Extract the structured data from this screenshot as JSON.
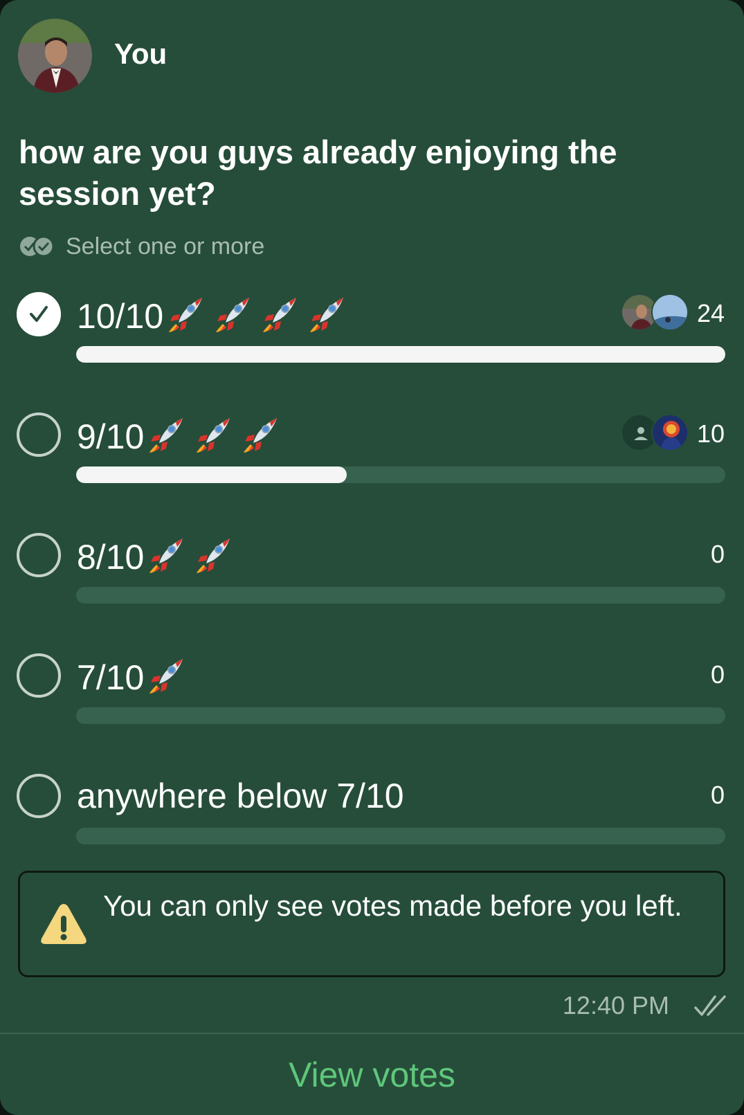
{
  "message": {
    "sender": "You",
    "avatar_icon": "user-photo",
    "time": "12:40 PM",
    "status_icon": "double-check-icon"
  },
  "poll": {
    "question": "how are you guys already enjoying the session yet?",
    "hint": "Select one or more",
    "hint_icon": "multi-check-icon",
    "options": [
      {
        "label": "10/10",
        "rockets": 4,
        "count": "24",
        "selected": true,
        "fill_fraction": 1.0,
        "voters": [
          "user-photo-avatar",
          "landscape-photo-avatar"
        ]
      },
      {
        "label": "9/10",
        "rockets": 3,
        "count": "10",
        "selected": false,
        "fill_fraction": 0.417,
        "voters": [
          "default-person-avatar",
          "superhero-photo-avatar"
        ]
      },
      {
        "label": "8/10",
        "rockets": 2,
        "count": "0",
        "selected": false,
        "fill_fraction": 0,
        "voters": []
      },
      {
        "label": "7/10",
        "rockets": 1,
        "count": "0",
        "selected": false,
        "fill_fraction": 0,
        "voters": []
      },
      {
        "label": "anywhere below 7/10",
        "rockets": 0,
        "count": "0",
        "selected": false,
        "fill_fraction": 0,
        "voters": []
      }
    ],
    "notice": "You can only see votes made before you left.",
    "notice_icon": "warning-icon",
    "view_votes_label": "View votes"
  },
  "colors": {
    "bubble": "#264d3a",
    "track": "#376250",
    "fill": "#f4f5f4",
    "accent": "#5ec77a",
    "muted_text": "#a9bdb1",
    "warning": "#f4d77e"
  }
}
